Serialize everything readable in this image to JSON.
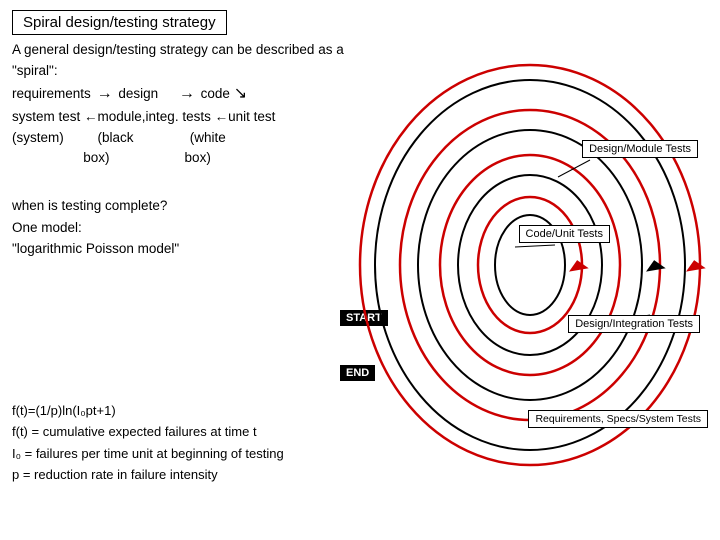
{
  "title": "Spiral design/testing strategy",
  "intro": {
    "line1": "A general design/testing strategy can be described as a \"spiral\":",
    "line2_part1": "requirements",
    "line2_arrow1": "→",
    "line2_part2": "design",
    "line2_arrow2": "→",
    "line2_part3": "code",
    "line3_part1": "system test ←module,integ. tests ←unit test",
    "line4_part1": "    (system)",
    "line4_part2": "(black",
    "line4_part3": "(white",
    "line5_part2": "box)",
    "line5_part3": "box)"
  },
  "when_testing": {
    "line1": "when is testing complete?",
    "line2": "One model:",
    "line3": "\"logarithmic Poisson model\""
  },
  "labels": {
    "design_module": "Design/Module Tests",
    "code_unit": "Code/Unit Tests",
    "design_integration": "Design/Integration Tests",
    "requirements": "Requirements, Specs/System Tests"
  },
  "start": "START",
  "end": "END",
  "formula": {
    "line1": "f(t)=(1/p)ln(I₀pt+1)",
    "line2": "f(t) = cumulative expected failures at time t",
    "line3": "I₀ = failures per time unit at beginning of testing",
    "line4": "p = reduction rate in failure intensity"
  }
}
